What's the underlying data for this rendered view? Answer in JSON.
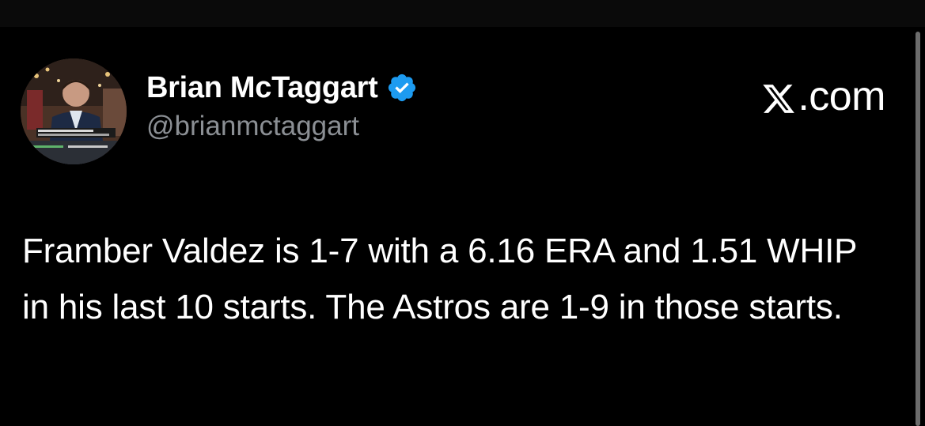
{
  "tweet": {
    "author": {
      "display_name": "Brian McTaggart",
      "handle": "@brianmctaggart",
      "verified": true,
      "avatar_icon": "avatar-photo"
    },
    "source_label": ".com",
    "source_icon": "x-logo-icon",
    "text": "Framber Valdez is 1-7 with a 6.16 ERA and 1.51 WHIP in his last 10 starts. The Astros are 1-9 in those starts."
  },
  "colors": {
    "background": "#000000",
    "text": "#ffffff",
    "handle": "#8b8f94",
    "verified_badge": "#1d9bf0"
  }
}
